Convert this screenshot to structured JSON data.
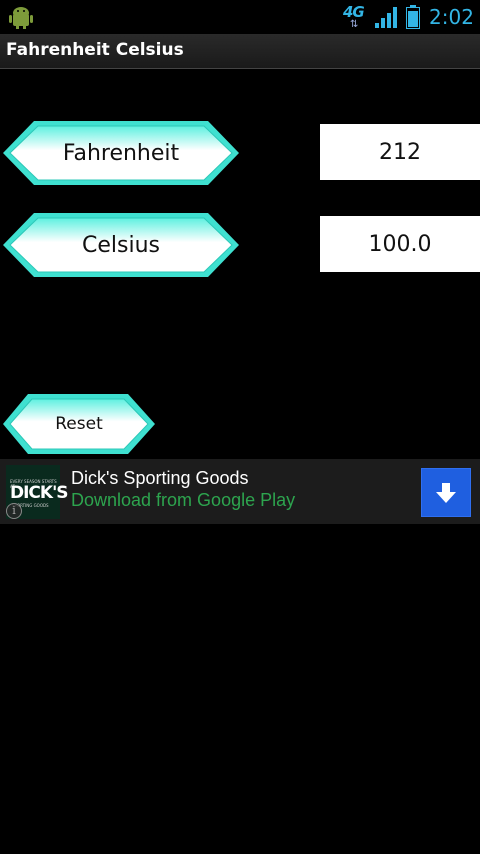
{
  "status_bar": {
    "network_label": "4G",
    "network_arrows": "⇅",
    "time": "2:02",
    "icons": [
      "android-icon",
      "signal-icon",
      "battery-icon"
    ],
    "accent_color": "#33b5e5"
  },
  "title_bar": {
    "title": "Fahrenheit Celsius"
  },
  "converter": {
    "fahrenheit_label": "Fahrenheit",
    "fahrenheit_value": "212",
    "celsius_label": "Celsius",
    "celsius_value": "100.0",
    "reset_label": "Reset",
    "button_border_color": "#3fe0d0"
  },
  "ad": {
    "logo_top_text": "EVERY SEASON STARTS AT",
    "logo_text": "DICK'S",
    "logo_bottom_text": "SPORTING GOODS",
    "title": "Dick's Sporting Goods",
    "subtitle": "Download from Google Play",
    "info_icon": "info-icon",
    "download_icon": "download-arrow-icon",
    "subtitle_color": "#2da44e",
    "button_color": "#1f5fe0"
  }
}
